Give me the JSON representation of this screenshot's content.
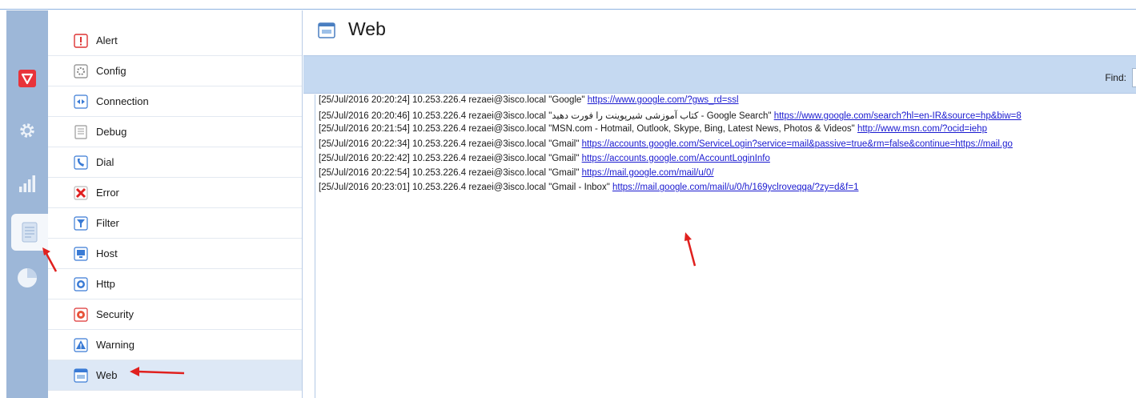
{
  "categories": [
    {
      "label": "Alert",
      "icon": "alert-icon"
    },
    {
      "label": "Config",
      "icon": "config-icon"
    },
    {
      "label": "Connection",
      "icon": "connection-icon"
    },
    {
      "label": "Debug",
      "icon": "debug-icon"
    },
    {
      "label": "Dial",
      "icon": "dial-icon"
    },
    {
      "label": "Error",
      "icon": "error-icon"
    },
    {
      "label": "Filter",
      "icon": "filter-icon"
    },
    {
      "label": "Host",
      "icon": "host-icon"
    },
    {
      "label": "Http",
      "icon": "http-icon"
    },
    {
      "label": "Security",
      "icon": "security-icon"
    },
    {
      "label": "Warning",
      "icon": "warning-icon"
    },
    {
      "label": "Web",
      "icon": "web-icon",
      "selected": true
    }
  ],
  "rail": {
    "items": [
      "shield-icon",
      "gear-icon",
      "signal-bars-icon",
      "log-document-icon",
      "pie-chart-icon"
    ],
    "active": "log-document-icon"
  },
  "header": {
    "title": "Web"
  },
  "toolbar": {
    "find_label": "Find:"
  },
  "log": [
    {
      "prefix": "[25/Jul/2016 20:20:24] 10.253.226.4 rezaei@3isco.local \"Google\" ",
      "url": "https://www.google.com/?gws_rd=ssl"
    },
    {
      "prefix": "[25/Jul/2016 20:20:46] 10.253.226.4 rezaei@3isco.local \"کتاب آموزشی شیرپوینت را فورت دهید - Google Search\" ",
      "url": "https://www.google.com/search?hl=en-IR&source=hp&biw=8"
    },
    {
      "prefix": "[25/Jul/2016 20:21:54] 10.253.226.4 rezaei@3isco.local \"MSN.com - Hotmail, Outlook, Skype, Bing, Latest News, Photos & Videos\" ",
      "url": "http://www.msn.com/?ocid=iehp"
    },
    {
      "prefix": "[25/Jul/2016 20:22:34] 10.253.226.4 rezaei@3isco.local \"Gmail\" ",
      "url": "https://accounts.google.com/ServiceLogin?service=mail&passive=true&rm=false&continue=https://mail.go"
    },
    {
      "prefix": "[25/Jul/2016 20:22:42] 10.253.226.4 rezaei@3isco.local \"Gmail\" ",
      "url": "https://accounts.google.com/AccountLoginInfo"
    },
    {
      "prefix": "[25/Jul/2016 20:22:54] 10.253.226.4 rezaei@3isco.local \"Gmail\" ",
      "url": "https://mail.google.com/mail/u/0/"
    },
    {
      "prefix": "[25/Jul/2016 20:23:01] 10.253.226.4 rezaei@3isco.local \"Gmail - Inbox\" ",
      "url": "https://mail.google.com/mail/u/0/h/169yclroveqqa/?zy=d&f=1"
    }
  ],
  "colors": {
    "rail": "#9db7d8",
    "toolbar": "#c5d9f1",
    "link": "#1a1ad0",
    "arrow": "#e0201e"
  }
}
